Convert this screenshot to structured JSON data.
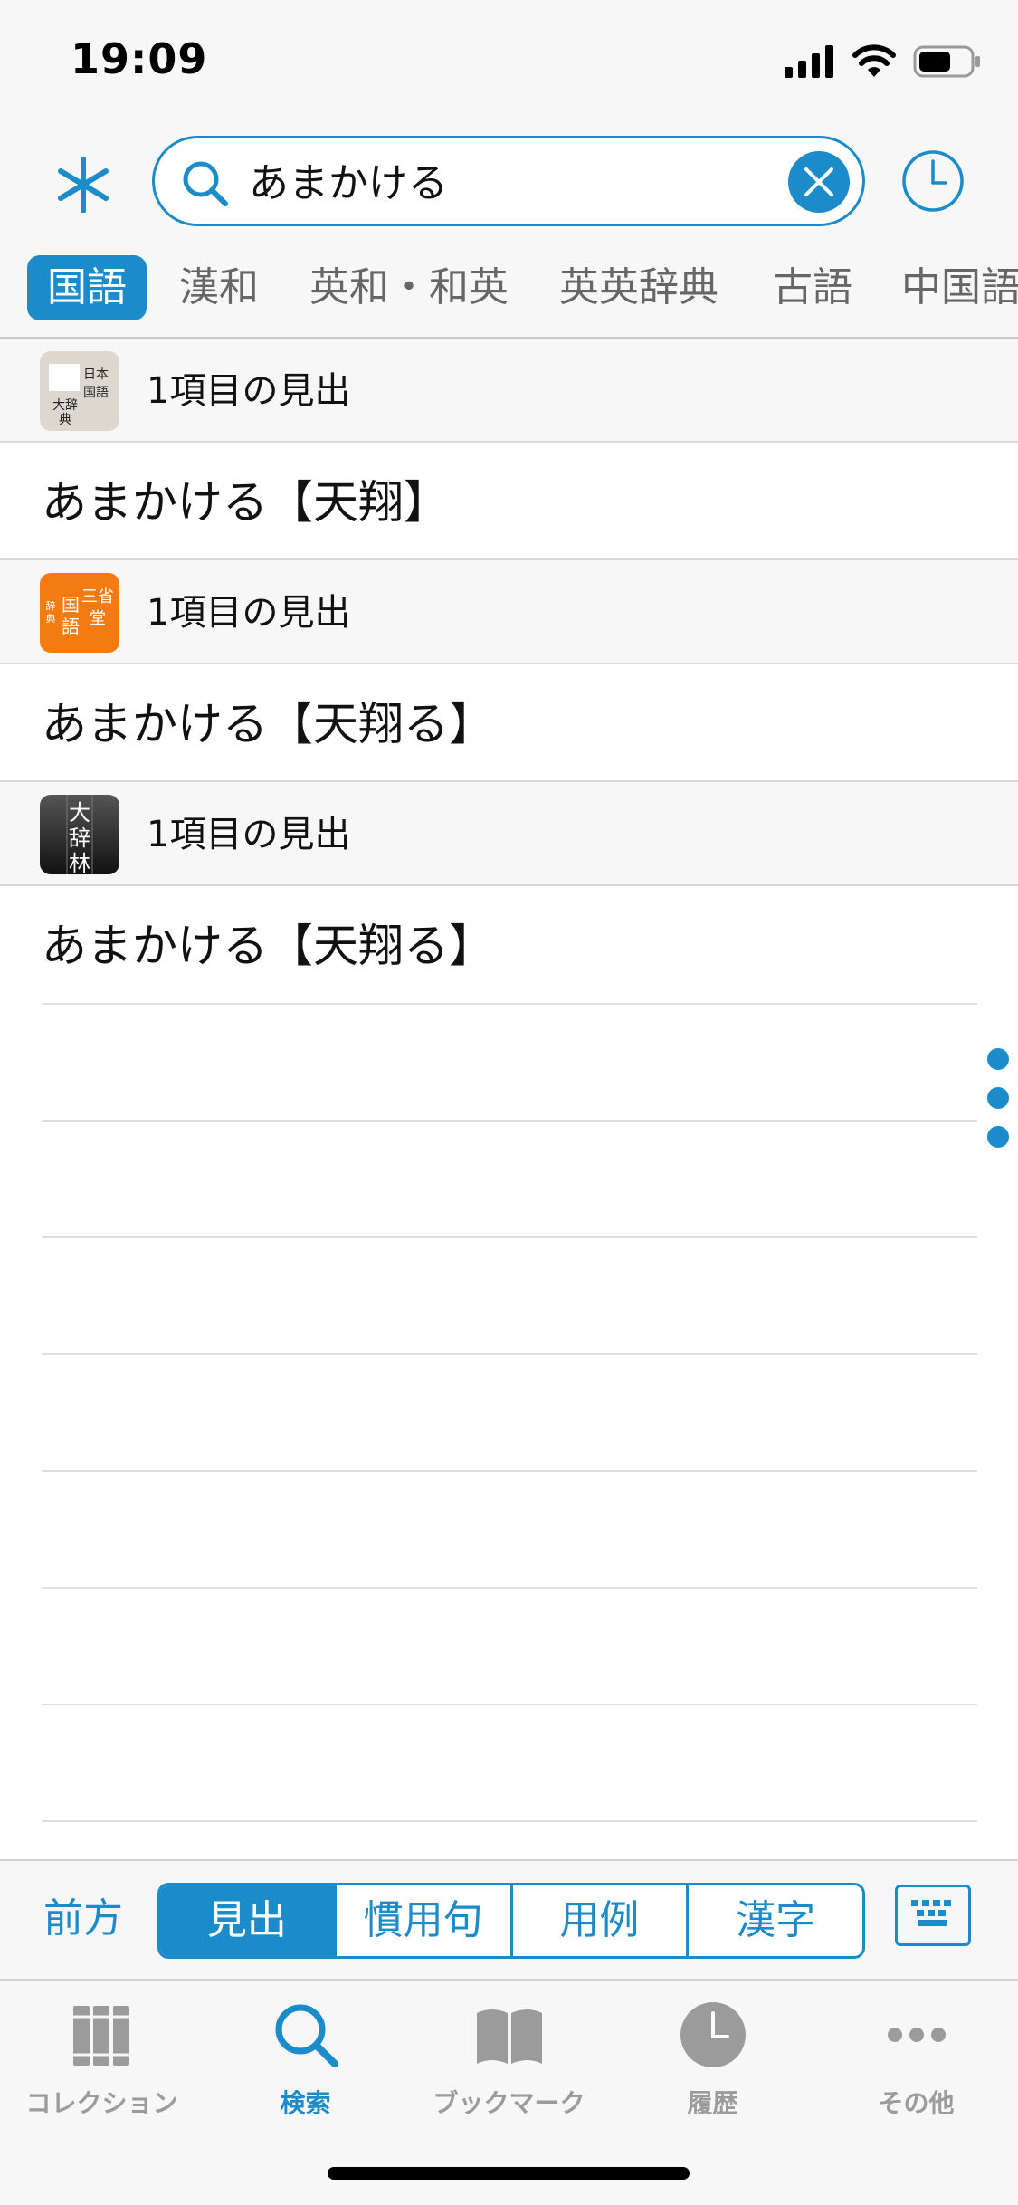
{
  "status_bar": {
    "time": "19:09"
  },
  "search": {
    "query": "あまかける"
  },
  "categories": [
    {
      "label": "国語",
      "active": true
    },
    {
      "label": "漢和",
      "active": false
    },
    {
      "label": "英和・和英",
      "active": false
    },
    {
      "label": "英英辞典",
      "active": false
    },
    {
      "label": "古語",
      "active": false
    },
    {
      "label": "中国語",
      "active": false
    }
  ],
  "sections": [
    {
      "dictionary_icon_text": "精選版 日本国語 大辞典",
      "count_label": "1項目の見出",
      "entries": [
        "あまかける【天翔】"
      ]
    },
    {
      "dictionary_icon_text": "三省堂 国語 辞典",
      "count_label": "1項目の見出",
      "entries": [
        "あまかける【天翔る】"
      ]
    },
    {
      "dictionary_icon_text": "大辞林",
      "count_label": "1項目の見出",
      "entries": [
        "あまかける【天翔る】"
      ]
    }
  ],
  "mode_bar": {
    "back_label": "前方",
    "segments": [
      {
        "label": "見出",
        "active": true
      },
      {
        "label": "慣用句",
        "active": false
      },
      {
        "label": "用例",
        "active": false
      },
      {
        "label": "漢字",
        "active": false
      }
    ]
  },
  "tab_bar": [
    {
      "label": "コレクション",
      "icon": "books-icon",
      "active": false
    },
    {
      "label": "検索",
      "icon": "search-icon",
      "active": true
    },
    {
      "label": "ブックマーク",
      "icon": "bookmark-book-icon",
      "active": false
    },
    {
      "label": "履歴",
      "icon": "clock-icon",
      "active": false
    },
    {
      "label": "その他",
      "icon": "more-icon",
      "active": false
    }
  ],
  "colors": {
    "accent": "#1b8cc9",
    "inactive": "#9b9b9b",
    "background": "#f7f7f7"
  }
}
